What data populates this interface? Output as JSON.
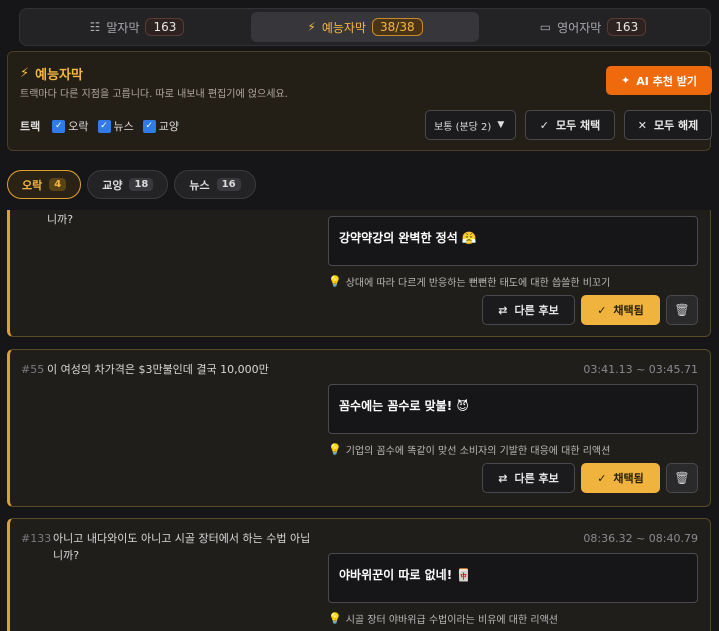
{
  "tabs": [
    {
      "icon": "☷",
      "label": "말자막",
      "count": "163"
    },
    {
      "icon": "⚡",
      "label": "예능자막",
      "count": "38/38"
    },
    {
      "icon": "▭",
      "label": "영어자막",
      "count": "163"
    }
  ],
  "panel": {
    "title": "예능자막",
    "description": "트랙마다 다른 지점을 고릅니다. 따로 내보내 편집기에 얹으세요.",
    "ai_button": "AI 추천 받기",
    "track_label": "트랙",
    "tracks": [
      "오락",
      "뉴스",
      "교양"
    ],
    "density_select": "보통 (분당 2)",
    "select_all": "모두 채택",
    "clear_all": "모두 해제"
  },
  "filters": [
    {
      "label": "오락",
      "count": "4"
    },
    {
      "label": "교양",
      "count": "18"
    },
    {
      "label": "뉴스",
      "count": "16"
    }
  ],
  "cards": [
    {
      "number": "",
      "text": "니까?",
      "time": "",
      "subtitle": "강약약강의 완벽한 정석 😤",
      "hint": "상대에 따라 다르게 반응하는 뻔뻔한 태도에 대한 씁쓸한 비꼬기"
    },
    {
      "number": "#55",
      "text": "이 여성의 차가격은 $3만불인데 결국 10,000만",
      "time": "03:41.13 ~ 03:45.71",
      "subtitle": "꼼수에는 꼼수로 맞불! 😈",
      "hint": "기업의 꼼수에 똑같이 맞선 소비자의 기발한 대응에 대한 리액션"
    },
    {
      "number": "#133",
      "text": "아니고 내다와이도 아니고 시골 장터에서 하는 수법 아닙니까?",
      "time": "08:36.32 ~ 08:40.79",
      "subtitle": "야바위꾼이 따로 없네! 🀄",
      "hint": "시골 장터 야바위급 수법이라는 비유에 대한 리액션"
    }
  ],
  "card_actions": {
    "alternate": "다른 후보",
    "adopted": "채택됨"
  }
}
